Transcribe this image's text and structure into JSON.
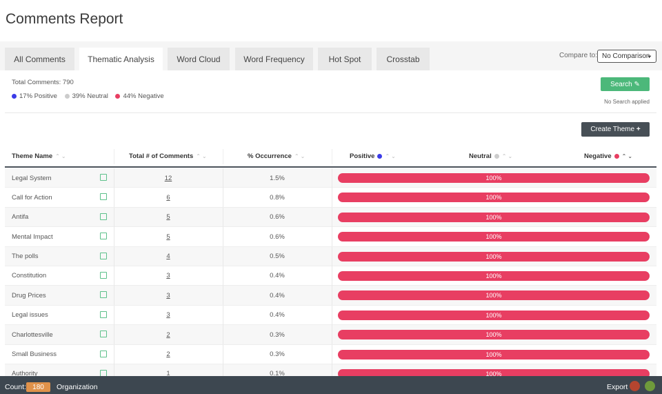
{
  "title": "Comments Report",
  "tabs": [
    {
      "label": "All Comments"
    },
    {
      "label": "Thematic Analysis",
      "active": true
    },
    {
      "label": "Word Cloud"
    },
    {
      "label": "Word Frequency"
    },
    {
      "label": "Hot Spot"
    },
    {
      "label": "Crosstab"
    }
  ],
  "compare": {
    "label": "Compare to:",
    "value": "No Comparison"
  },
  "summary": {
    "total": "Total Comments: 790",
    "positive": "17% Positive",
    "neutral": "39% Neutral",
    "negative": "44% Negative"
  },
  "colors": {
    "positive": "#3b3be8",
    "neutral": "#cccccc",
    "negative": "#e83e62",
    "search": "#4cb87a",
    "footer": "#3d4750",
    "badge": "#e0924a"
  },
  "search": {
    "label": "Search",
    "status": "No Search applied"
  },
  "create_theme": "Create Theme",
  "columns": [
    "Theme Name",
    "Total # of Comments",
    "% Occurrence",
    "Positive",
    "Neutral",
    "Negative"
  ],
  "rows": [
    {
      "name": "Legal System",
      "count": "12",
      "pct": "1.5%",
      "bar": "100%"
    },
    {
      "name": "Call for Action",
      "count": "6",
      "pct": "0.8%",
      "bar": "100%"
    },
    {
      "name": "Antifa",
      "count": "5",
      "pct": "0.6%",
      "bar": "100%"
    },
    {
      "name": "Mental Impact",
      "count": "5",
      "pct": "0.6%",
      "bar": "100%"
    },
    {
      "name": "The polls",
      "count": "4",
      "pct": "0.5%",
      "bar": "100%"
    },
    {
      "name": "Constitution",
      "count": "3",
      "pct": "0.4%",
      "bar": "100%"
    },
    {
      "name": "Drug Prices",
      "count": "3",
      "pct": "0.4%",
      "bar": "100%"
    },
    {
      "name": "Legal issues",
      "count": "3",
      "pct": "0.4%",
      "bar": "100%"
    },
    {
      "name": "Charlottesville",
      "count": "2",
      "pct": "0.3%",
      "bar": "100%"
    },
    {
      "name": "Small Business",
      "count": "2",
      "pct": "0.3%",
      "bar": "100%"
    },
    {
      "name": "Authority",
      "count": "1",
      "pct": "0.1%",
      "bar": "100%"
    }
  ],
  "footer": {
    "count_label": "Count:",
    "count": "180",
    "organization": "Organization",
    "export": "Export"
  }
}
